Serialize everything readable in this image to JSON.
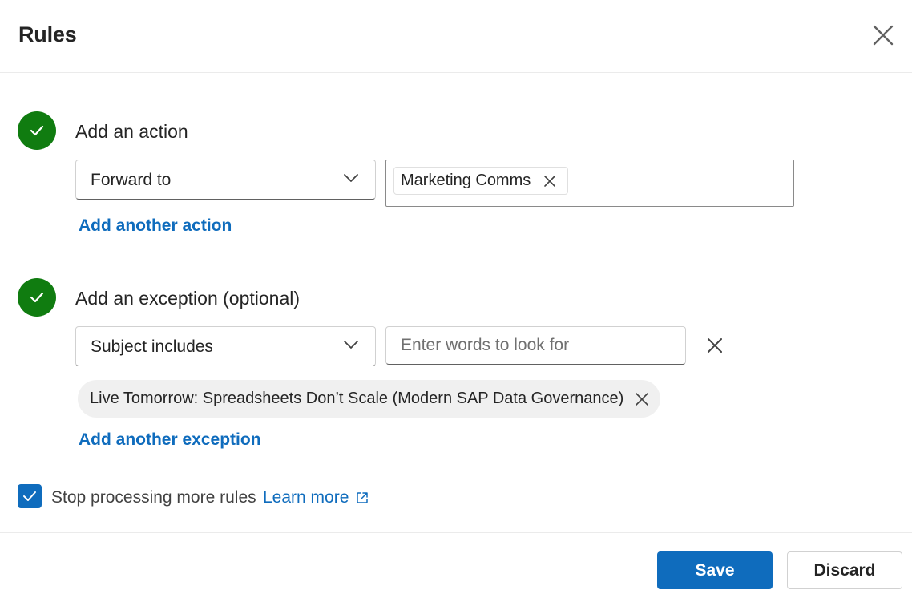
{
  "dialog": {
    "title": "Rules"
  },
  "action_section": {
    "title": "Add an action",
    "dropdown_value": "Forward to",
    "recipients": [
      "Marketing Comms"
    ],
    "add_link": "Add another action"
  },
  "exception_section": {
    "title": "Add an exception (optional)",
    "dropdown_value": "Subject includes",
    "input_placeholder": "Enter words to look for",
    "input_value": "",
    "keywords": [
      "Live Tomorrow: Spreadsheets Don’t Scale (Modern SAP Data Governance)"
    ],
    "add_link": "Add another exception"
  },
  "stop_processing": {
    "checked": true,
    "label": "Stop processing more rules",
    "learn_more": "Learn more"
  },
  "footer": {
    "save_label": "Save",
    "discard_label": "Discard"
  },
  "icons": {
    "close": "close-icon",
    "check": "checkmark-icon",
    "chevron": "chevron-down-icon",
    "dismiss": "dismiss-icon",
    "external": "open-external-icon"
  },
  "colors": {
    "accent": "#0f6cbd",
    "success": "#107c10",
    "text": "#242424"
  }
}
